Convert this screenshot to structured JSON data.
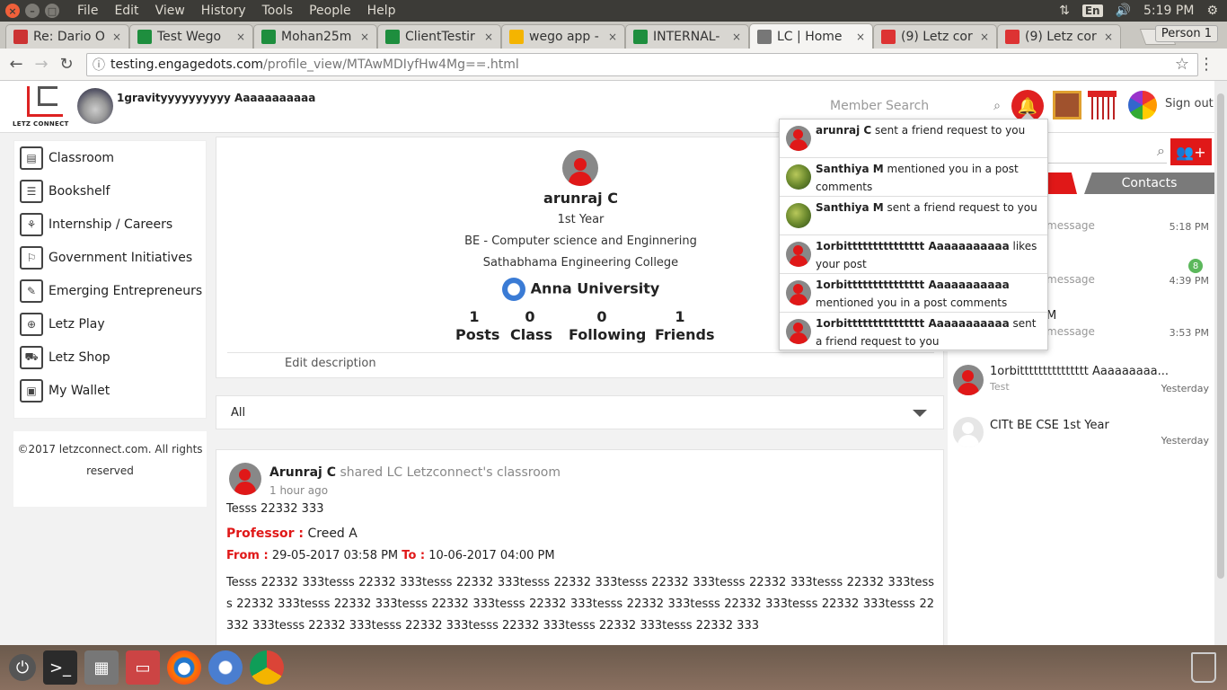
{
  "os": {
    "menu": [
      "File",
      "Edit",
      "View",
      "History",
      "Tools",
      "People",
      "Help"
    ],
    "lang": "En",
    "time": "5:19 PM"
  },
  "browser": {
    "tabs": [
      {
        "label": "Re: Dario O",
        "color": "#c33"
      },
      {
        "label": "Test Wego",
        "color": "#1e8e3e"
      },
      {
        "label": "Mohan25m",
        "color": "#1e8e3e"
      },
      {
        "label": "ClientTestir",
        "color": "#1e8e3e"
      },
      {
        "label": "wego app -",
        "color": "#f4b400"
      },
      {
        "label": "INTERNAL-",
        "color": "#1e8e3e"
      },
      {
        "label": "LC | Home",
        "color": "#777"
      },
      {
        "label": "(9) Letz cor",
        "color": "#d33"
      },
      {
        "label": "(9) Letz cor",
        "color": "#d33"
      }
    ],
    "person": "Person 1",
    "url_host": "testing.engagedots.com",
    "url_path": "/profile_view/MTAwMDIyfHw4Mg==.html"
  },
  "header": {
    "logo_text": "LETZ CONNECT",
    "user_name": "1gravityyyyyyyyyy Aaaaaaaaaaa",
    "search_placeholder": "Member Search",
    "sign_out": "Sign out"
  },
  "leftnav": {
    "items": [
      {
        "label": "Classroom",
        "icon": "classroom-icon"
      },
      {
        "label": "Bookshelf",
        "icon": "bookshelf-icon"
      },
      {
        "label": "Internship / Careers",
        "icon": "careers-icon"
      },
      {
        "label": "Government Initiatives",
        "icon": "government-icon"
      },
      {
        "label": "Emerging Entrepreneurs",
        "icon": "entrepreneur-icon"
      },
      {
        "label": "Letz Play",
        "icon": "gamepad-icon"
      },
      {
        "label": "Letz Shop",
        "icon": "cart-icon"
      },
      {
        "label": "My Wallet",
        "icon": "wallet-icon"
      }
    ],
    "footer": "©2017 letzconnect.com. All rights reserved"
  },
  "profile": {
    "name": "arunraj C",
    "year": "1st Year",
    "dept": "BE - Computer science and Enginnering",
    "college": "Sathabhama Engineering College",
    "university": "Anna University",
    "stats": [
      {
        "value": "1",
        "label": "Posts"
      },
      {
        "value": "0",
        "label": "Class"
      },
      {
        "value": "0",
        "label": "Following"
      },
      {
        "value": "1",
        "label": "Friends"
      }
    ],
    "edit_description": "Edit description"
  },
  "filter": {
    "selected": "All"
  },
  "post": {
    "author": "Arunraj C",
    "action": "shared LC Letzconnect's classroom",
    "time": "1 hour ago",
    "title": "Tesss 22332 333",
    "professor_label": "Professor :",
    "professor": "Creed A",
    "from_label": "From :",
    "from": "29-05-2017 03:58 PM",
    "to_label": "To :",
    "to": "10-06-2017 04:00 PM",
    "body": "Tesss 22332 333tesss 22332 333tesss 22332 333tesss 22332 333tesss 22332 333tesss 22332 333tesss 22332 333tesss 22332 333tesss 22332 333tesss 22332 333tesss 22332 333tesss 22332 333tesss 22332 333tesss 22332 333tesss 22332 333tesss 22332 333tesss 22332 333tesss 22332 333tesss 22332 333tesss 22332 333"
  },
  "rightpane": {
    "contacts_tab": "Contacts",
    "rows": [
      {
        "sub": "message",
        "time": "5:18 PM"
      },
      {
        "sub": "message",
        "time": "4:39 PM",
        "badge": "8"
      },
      {
        "sub": "message",
        "time": "3:53 PM",
        "prefix": "M"
      },
      {
        "name": "1orbittttttttttttttt Aaaaaaaaa...",
        "sub": "Test",
        "time": "Yesterday"
      },
      {
        "name": "CITt BE CSE 1st Year",
        "sub": "",
        "time": "Yesterday"
      }
    ]
  },
  "notifications": [
    {
      "who": "arunraj C",
      "text": " sent a friend request to you",
      "photo": false
    },
    {
      "who": "Santhiya M",
      "text": " mentioned you in a post comments",
      "photo": true
    },
    {
      "who": "Santhiya M",
      "text": " sent a friend request to you",
      "photo": true
    },
    {
      "who": "1orbittttttttttttttt Aaaaaaaaaaa",
      "text": " likes your post",
      "photo": false
    },
    {
      "who": "1orbittttttttttttttt Aaaaaaaaaaa",
      "text": " mentioned you in a post comments",
      "photo": false
    },
    {
      "who": "1orbittttttttttttttt Aaaaaaaaaaa",
      "text": " sent a friend request to you",
      "photo": false
    }
  ]
}
